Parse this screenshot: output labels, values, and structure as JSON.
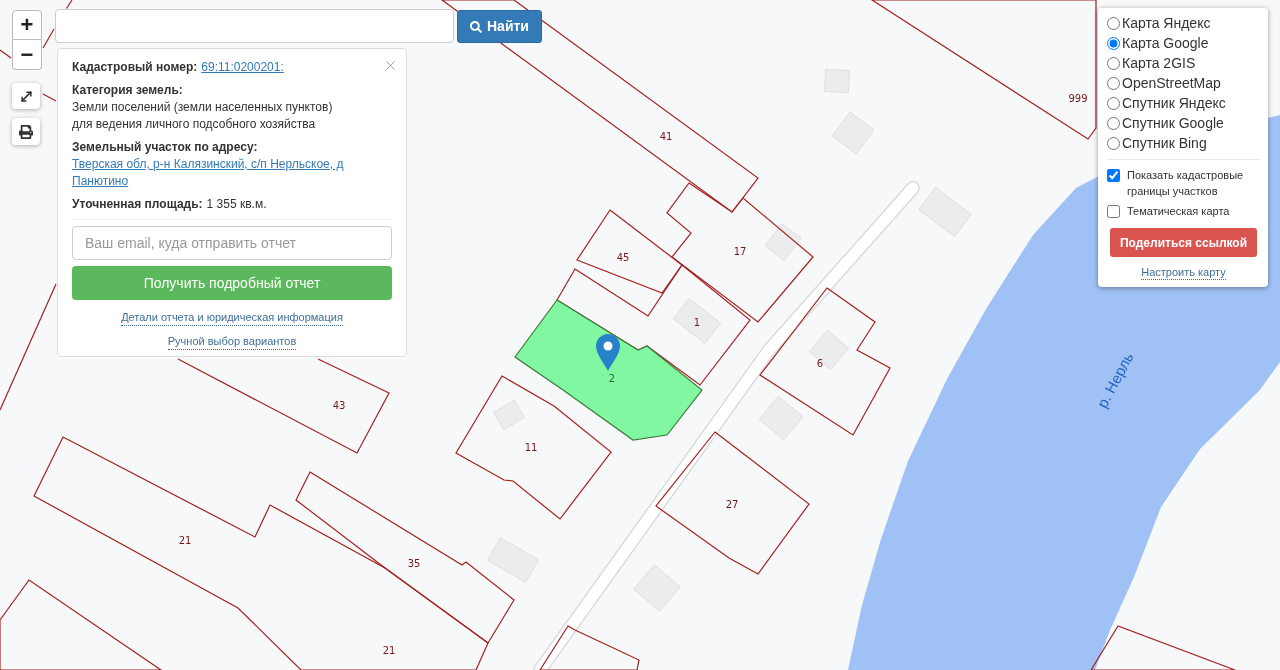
{
  "zoom_controls": [
    {
      "label": "+"
    },
    {
      "label": "−"
    }
  ],
  "search": {
    "button": "Найти"
  },
  "info_panel": {
    "fields": [
      {
        "kind": "link",
        "label": "Кадастровый номер:",
        "value": "69:11:0200201:"
      },
      {
        "kind": "text",
        "label": "Категория земель:",
        "value": "Земли поселений (земли населенных пунктов)",
        "note": "для ведения личного подсобного хозяйства"
      },
      {
        "kind": "link",
        "label": "Земельный участок по адресу:",
        "value": "Тверская обл, р-н Калязинский, с/п Нерльское, д Панютино"
      },
      {
        "kind": "text",
        "label": "Уточненная площадь:",
        "value": "1 355 кв.м."
      }
    ],
    "email": {
      "placeholder": "Ваш email, куда отправить отчет"
    },
    "report_button": "Получить подробный отчет",
    "links": [
      "Детали отчета и юридическая информация",
      "Ручной выбор вариантов"
    ]
  },
  "layer_panel": {
    "layers": [
      {
        "label": "Карта Яндекс",
        "selected": false
      },
      {
        "label": "Карта Google",
        "selected": true
      },
      {
        "label": "Карта 2GIS",
        "selected": false
      },
      {
        "label": "OpenStreetMap",
        "selected": false
      },
      {
        "label": "Спутник Яндекс",
        "selected": false
      },
      {
        "label": "Спутник Google",
        "selected": false
      },
      {
        "label": "Спутник Bing",
        "selected": false
      }
    ],
    "overlays": [
      {
        "label": "Показать кадастровые границы участков",
        "checked": true
      },
      {
        "label": "Тематическая карта",
        "checked": false
      }
    ],
    "share_button": "Поделиться ссылкой",
    "settings_link": "Настроить карту"
  },
  "map": {
    "parcels": [
      {
        "labels": [
          "41"
        ],
        "selected": false
      },
      {
        "labels": [
          "999"
        ],
        "selected": false
      },
      {
        "labels": [
          "45"
        ],
        "selected": false
      },
      {
        "labels": [
          "17"
        ],
        "selected": false
      },
      {
        "labels": [
          "1"
        ],
        "selected": false
      },
      {
        "labels": [
          "2"
        ],
        "selected": true
      },
      {
        "labels": [
          "6"
        ],
        "selected": false
      },
      {
        "labels": [
          "43"
        ],
        "selected": false
      },
      {
        "labels": [
          "11"
        ],
        "selected": false
      },
      {
        "labels": [
          "27"
        ],
        "selected": false
      },
      {
        "labels": [
          "21",
          "21"
        ],
        "selected": false
      },
      {
        "labels": [
          "35"
        ],
        "selected": false
      }
    ],
    "river_label": "р. Нерль"
  }
}
